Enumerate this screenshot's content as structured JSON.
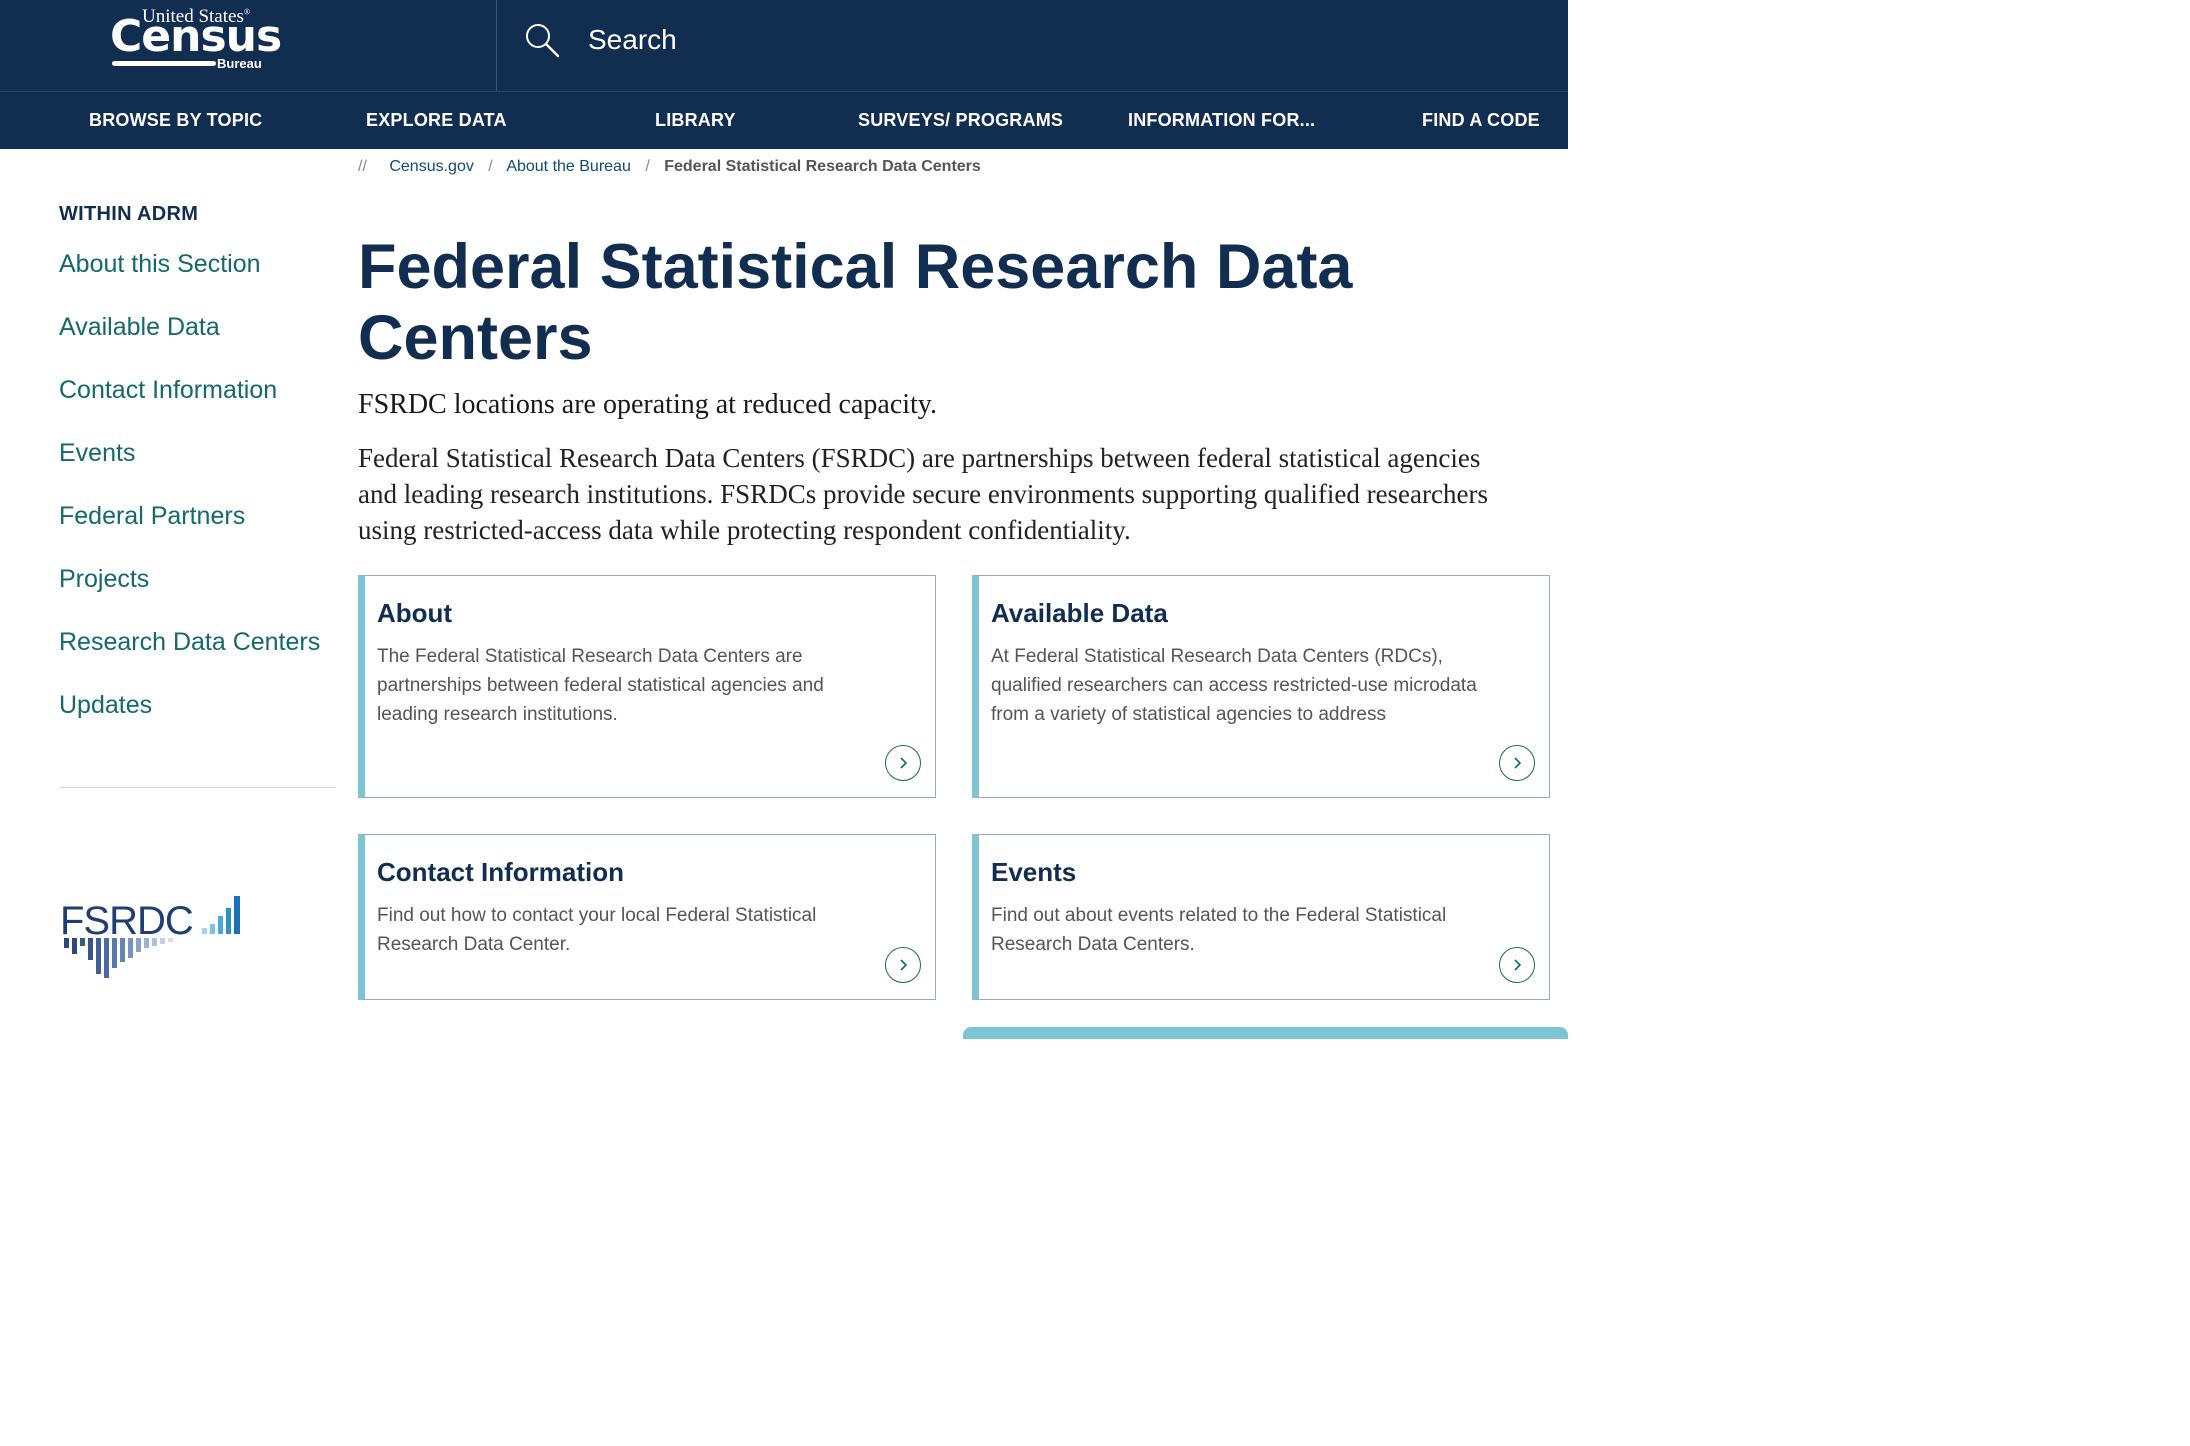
{
  "header": {
    "logo": {
      "united_states": "United States",
      "census": "Census",
      "bureau": "Bureau"
    },
    "search": {
      "label": "Search",
      "icon": "search-icon"
    }
  },
  "nav": {
    "items": [
      {
        "label": "BROWSE BY TOPIC"
      },
      {
        "label": "EXPLORE DATA"
      },
      {
        "label": "LIBRARY"
      },
      {
        "label": "SURVEYS/ PROGRAMS"
      },
      {
        "label": "INFORMATION FOR..."
      },
      {
        "label": "FIND A CODE"
      }
    ]
  },
  "breadcrumb": {
    "prefix": "//",
    "items": [
      {
        "label": "Census.gov"
      },
      {
        "label": "About the Bureau"
      },
      {
        "label": "Federal Statistical Research Data Centers"
      }
    ],
    "separator": "/"
  },
  "sidebar": {
    "heading": "WITHIN ADRM",
    "items": [
      {
        "label": "About this Section"
      },
      {
        "label": "Available Data"
      },
      {
        "label": "Contact Information"
      },
      {
        "label": "Events"
      },
      {
        "label": "Federal Partners"
      },
      {
        "label": "Projects"
      },
      {
        "label": "Research Data Centers"
      },
      {
        "label": "Updates"
      }
    ],
    "logo_text": "FSRDC"
  },
  "main": {
    "title": "Federal Statistical Research Data Centers",
    "notice": "FSRDC locations are operating at reduced capacity.",
    "intro": "Federal Statistical Research Data Centers (FSRDC) are partnerships between federal statistical agencies and leading research institutions. FSRDCs provide secure environments supporting qualified researchers using restricted-access data while protecting respondent confidentiality.",
    "cards": [
      {
        "title": "About",
        "text": "The Federal Statistical Research Data Centers are partnerships between federal statistical agencies and leading research institutions."
      },
      {
        "title": "Available Data",
        "text": "At Federal Statistical Research Data Centers (RDCs), qualified researchers can access restricted-use microdata from a variety of statistical agencies to address"
      },
      {
        "title": "Contact Information",
        "text": "Find out how to contact your local Federal Statistical Research Data Center."
      },
      {
        "title": "Events",
        "text": "Find out about events related to the Federal Statistical Research Data Centers."
      }
    ]
  },
  "colors": {
    "header_bg": "#112e51",
    "link_teal": "#13696b",
    "card_accent": "#7dc4d4",
    "title_navy": "#112e51"
  }
}
